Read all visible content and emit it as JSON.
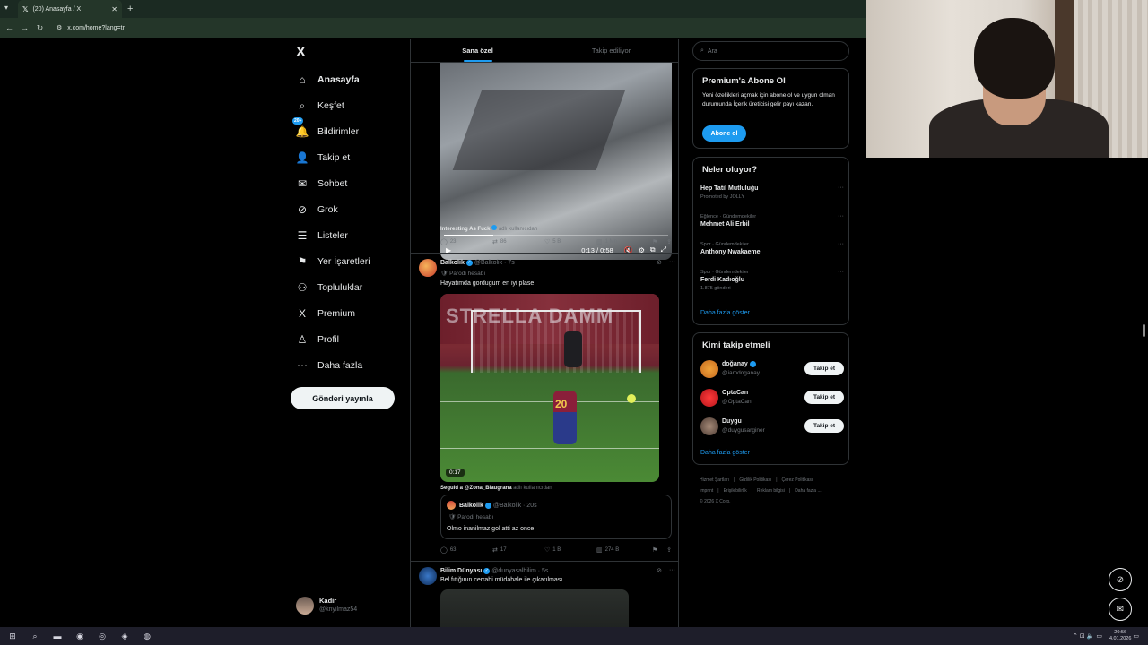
{
  "browser": {
    "tab_title": "(20) Anasayfa / X",
    "tab_favicon": "x-logo",
    "url": "x.com/home?lang=tr"
  },
  "sidebar": {
    "logo": "X",
    "items": [
      {
        "label": "Anasayfa",
        "icon": "home-icon",
        "glyph": "⌂",
        "active": true
      },
      {
        "label": "Keşfet",
        "icon": "search-icon",
        "glyph": "⌕"
      },
      {
        "label": "Bildirimler",
        "icon": "bell-icon",
        "glyph": "🔔",
        "badge": "20+"
      },
      {
        "label": "Takip et",
        "icon": "person-add-icon",
        "glyph": "👤"
      },
      {
        "label": "Sohbet",
        "icon": "mail-icon",
        "glyph": "✉"
      },
      {
        "label": "Grok",
        "icon": "grok-icon",
        "glyph": "⊘"
      },
      {
        "label": "Listeler",
        "icon": "list-icon",
        "glyph": "☰"
      },
      {
        "label": "Yer İşaretleri",
        "icon": "bookmark-icon",
        "glyph": "⚑"
      },
      {
        "label": "Topluluklar",
        "icon": "communities-icon",
        "glyph": "⚇"
      },
      {
        "label": "Premium",
        "icon": "x-premium-icon",
        "glyph": "X"
      },
      {
        "label": "Profil",
        "icon": "profile-icon",
        "glyph": "♙"
      },
      {
        "label": "Daha fazla",
        "icon": "more-circle-icon",
        "glyph": "⋯"
      }
    ],
    "post_button": "Gönderi yayınla",
    "account": {
      "name": "Kadir",
      "handle": "@knyilmaz54"
    }
  },
  "feed": {
    "tabs": [
      {
        "label": "Sana özel",
        "active": true
      },
      {
        "label": "Takip ediliyor",
        "active": false
      }
    ],
    "tweet1": {
      "video_time": "0:13 / 0:58",
      "progress": 0.22,
      "source_name": "Interesting As Fuck",
      "source_suffix": "adlı kullanıcıdan",
      "replies": "23",
      "retweets": "86",
      "likes": "5 B",
      "views": "1 Mn"
    },
    "tweet2": {
      "name": "Balkolik",
      "handle": "@Balkolik · 7s",
      "subtitle": "Parodi hesabı",
      "text": "Hayatımda gordugum en iyi plase",
      "stadium_text": "STRELLA DAMM",
      "video_duration": "0:17",
      "source_name": "Seguid a @Zona_Blaugrana",
      "source_suffix": "adlı kullanıcıdan",
      "quote": {
        "name": "Balkolik",
        "handle": "@Balkolik · 20s",
        "subtitle": "Parodi hesabı",
        "text": "Olmo inanilmaz gol atti az once"
      },
      "replies": "63",
      "retweets": "17",
      "likes": "1 B",
      "views": "274 B"
    },
    "tweet3": {
      "name": "Bilim Dünyası",
      "handle": "@dunyasalbilim · 5s",
      "text": "Bel fıtığının cerrahi müdahale ile çıkarılması."
    }
  },
  "right": {
    "search_placeholder": "Ara",
    "premium": {
      "title": "Premium'a Abone Ol",
      "text": "Yeni özellikleri açmak için abone ol ve uygun olman durumunda İçerik üreticisi gelir payı kazan.",
      "button": "Abone ol"
    },
    "trends": {
      "title": "Neler oluyor?",
      "items": [
        {
          "category": "",
          "name": "Hep Tatil Mutluluğu",
          "meta": "Promoted by JOLLY"
        },
        {
          "category": "Eğlence · Gündemdekiler",
          "name": "Mehmet Ali Erbil",
          "meta": ""
        },
        {
          "category": "Spor · Gündemdekiler",
          "name": "Anthony Nwakaeme",
          "meta": ""
        },
        {
          "category": "Spor · Gündemdekiler",
          "name": "Ferdi Kadıoğlu",
          "meta": "1.875 gönderi"
        }
      ],
      "show_more": "Daha fazla göster"
    },
    "who": {
      "title": "Kimi takip etmeli",
      "items": [
        {
          "name": "doğanay",
          "handle": "@iamdoganay",
          "button": "Takip et",
          "verified": true
        },
        {
          "name": "OptaCan",
          "handle": "@OptaCan",
          "button": "Takip et",
          "verified": false
        },
        {
          "name": "Duygu",
          "handle": "@duygusarginer",
          "button": "Takip et",
          "verified": false
        }
      ],
      "show_more": "Daha fazla göster"
    },
    "footer": {
      "line1": [
        "Hizmet Şartları",
        "Gizlilik Politikası",
        "Çerez Politikası"
      ],
      "line2": [
        "Imprint",
        "Erişilebilirlik",
        "Reklam bilgisi",
        "Daha fazla ..."
      ],
      "line3": "© 2026 X Corp."
    }
  },
  "taskbar": {
    "time": "20:56",
    "date": "4.01.2026"
  }
}
